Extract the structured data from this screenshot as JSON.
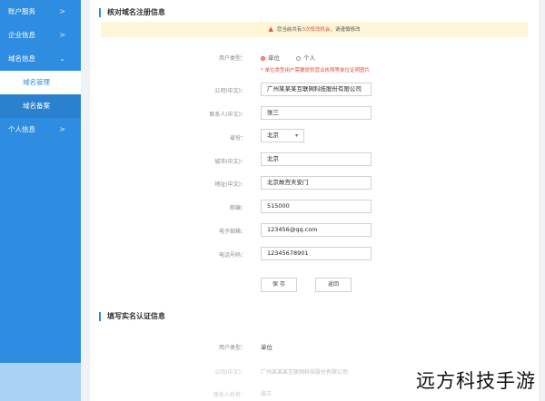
{
  "sidebar": {
    "items": [
      {
        "label": "账户服务",
        "chevron": ">"
      },
      {
        "label": "企业信息",
        "chevron": ">"
      },
      {
        "label": "域名信息",
        "chevron": "⌄"
      },
      {
        "label": "域名管理"
      },
      {
        "label": "域名备案"
      },
      {
        "label": "个人信息",
        "chevron": ">"
      }
    ]
  },
  "section1": {
    "title": "核对域名注册信息",
    "warning": {
      "prefix": "您当前共有",
      "highlight": "3次修改机会",
      "suffix": "，请谨慎修改"
    },
    "user_type_label": "用户类型：",
    "options": [
      "单位",
      "个人"
    ],
    "hint": "* 单位类型用户需要提供营业执照等单位证明图片",
    "fields": [
      {
        "label": "公司(中文)：",
        "value": "广州某某某互联网科技股份有限公司"
      },
      {
        "label": "联系人(中文)：",
        "value": "张三"
      },
      {
        "label": "省份：",
        "value": "北京"
      },
      {
        "label": "城市(中文)：",
        "value": "北京"
      },
      {
        "label": "地址(中文)：",
        "value": "北京故宫天安门"
      },
      {
        "label": "邮编：",
        "value": "515000"
      },
      {
        "label": "电子邮箱：",
        "value": "123456@qq.com"
      },
      {
        "label": "电话号码：",
        "value": "12345678901"
      }
    ],
    "save_label": "保 存",
    "back_label": "返回"
  },
  "section2": {
    "title": "填写实名认证信息",
    "rows": [
      {
        "label": "用户类型：",
        "value": "单位"
      },
      {
        "label": "公司(中文)：",
        "value": "广州某某某互联网科技股份有限公司"
      },
      {
        "label": "联系人姓名：",
        "value": "张三"
      }
    ]
  },
  "watermark": "远方科技手游",
  "colors": {
    "accent": "#2e8de0",
    "warning": "#e2503c",
    "warning_bg": "#fdf6d8"
  }
}
